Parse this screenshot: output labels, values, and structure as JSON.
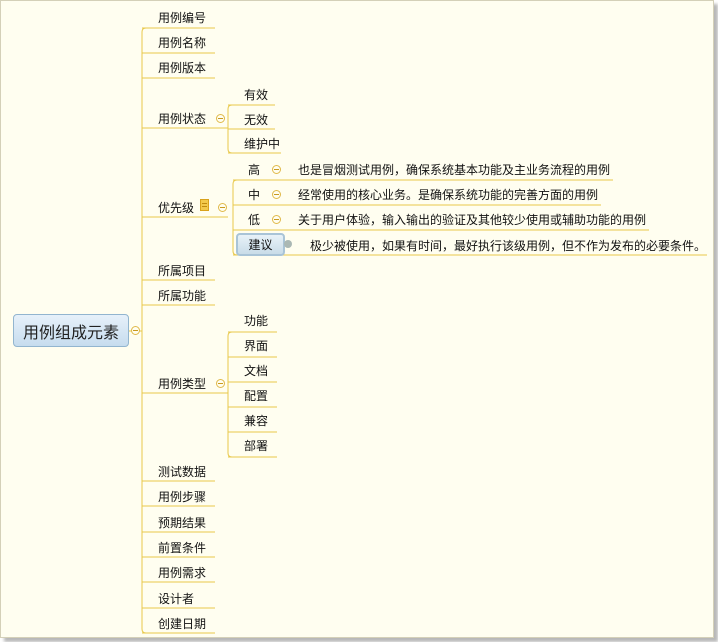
{
  "root": "用例组成元素",
  "branches": {
    "id": "用例编号",
    "name": "用例名称",
    "version": "用例版本",
    "status": "用例状态",
    "priority": "优先级",
    "project": "所属项目",
    "function": "所属功能",
    "type": "用例类型",
    "test_data": "测试数据",
    "steps": "用例步骤",
    "expected": "预期结果",
    "precondition": "前置条件",
    "requirement": "用例需求",
    "designer": "设计者",
    "created": "创建日期"
  },
  "status_children": [
    "有效",
    "无效",
    "维护中"
  ],
  "priority_children": [
    {
      "level": "高",
      "desc": "也是冒烟测试用例，确保系统基本功能及主业务流程的用例"
    },
    {
      "level": "中",
      "desc": "经常使用的核心业务。是确保系统功能的完善方面的用例"
    },
    {
      "level": "低",
      "desc": "关于用户体验，输入输出的验证及其他较少使用或辅助功能的用例"
    },
    {
      "level": "建议",
      "desc": "极少被使用，如果有时间，最好执行该级用例，但不作为发布的必要条件。"
    }
  ],
  "type_children": [
    "功能",
    "界面",
    "文档",
    "配置",
    "兼容",
    "部署"
  ],
  "colors": {
    "background": "#fffef0",
    "branch_line": "#e8c84a",
    "root_fill": "#c6dcee",
    "root_border": "#92b5cf"
  },
  "icons": {
    "collapse": "minus-circle-icon",
    "note": "note-icon",
    "marker": "dot-marker-icon"
  }
}
